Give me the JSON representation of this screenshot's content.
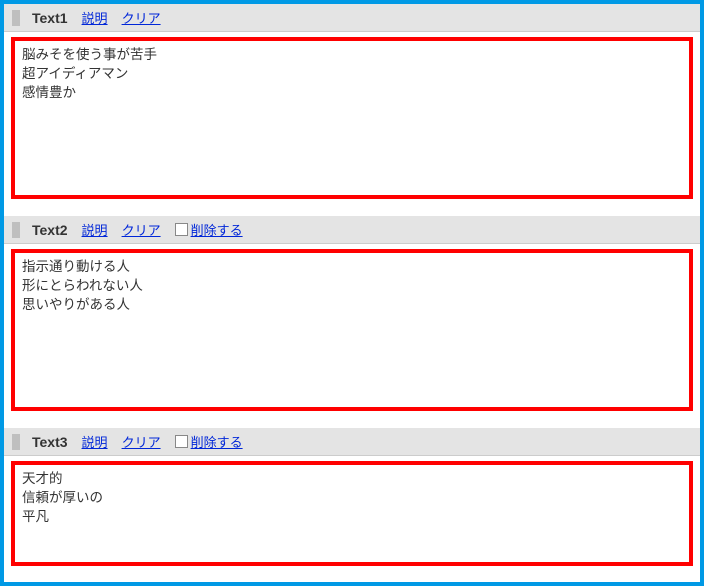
{
  "sections": [
    {
      "title": "Text1",
      "explain_label": "説明",
      "clear_label": "クリア",
      "has_delete": false,
      "delete_label": "",
      "value": "脳みそを使う事が苦手\n超アイディアマン\n感情豊か"
    },
    {
      "title": "Text2",
      "explain_label": "説明",
      "clear_label": "クリア",
      "has_delete": true,
      "delete_label": "削除する",
      "value": "指示通り動ける人\n形にとらわれない人\n思いやりがある人"
    },
    {
      "title": "Text3",
      "explain_label": "説明",
      "clear_label": "クリア",
      "has_delete": true,
      "delete_label": "削除する",
      "value": "天才的\n信頼が厚いの\n平凡"
    }
  ]
}
